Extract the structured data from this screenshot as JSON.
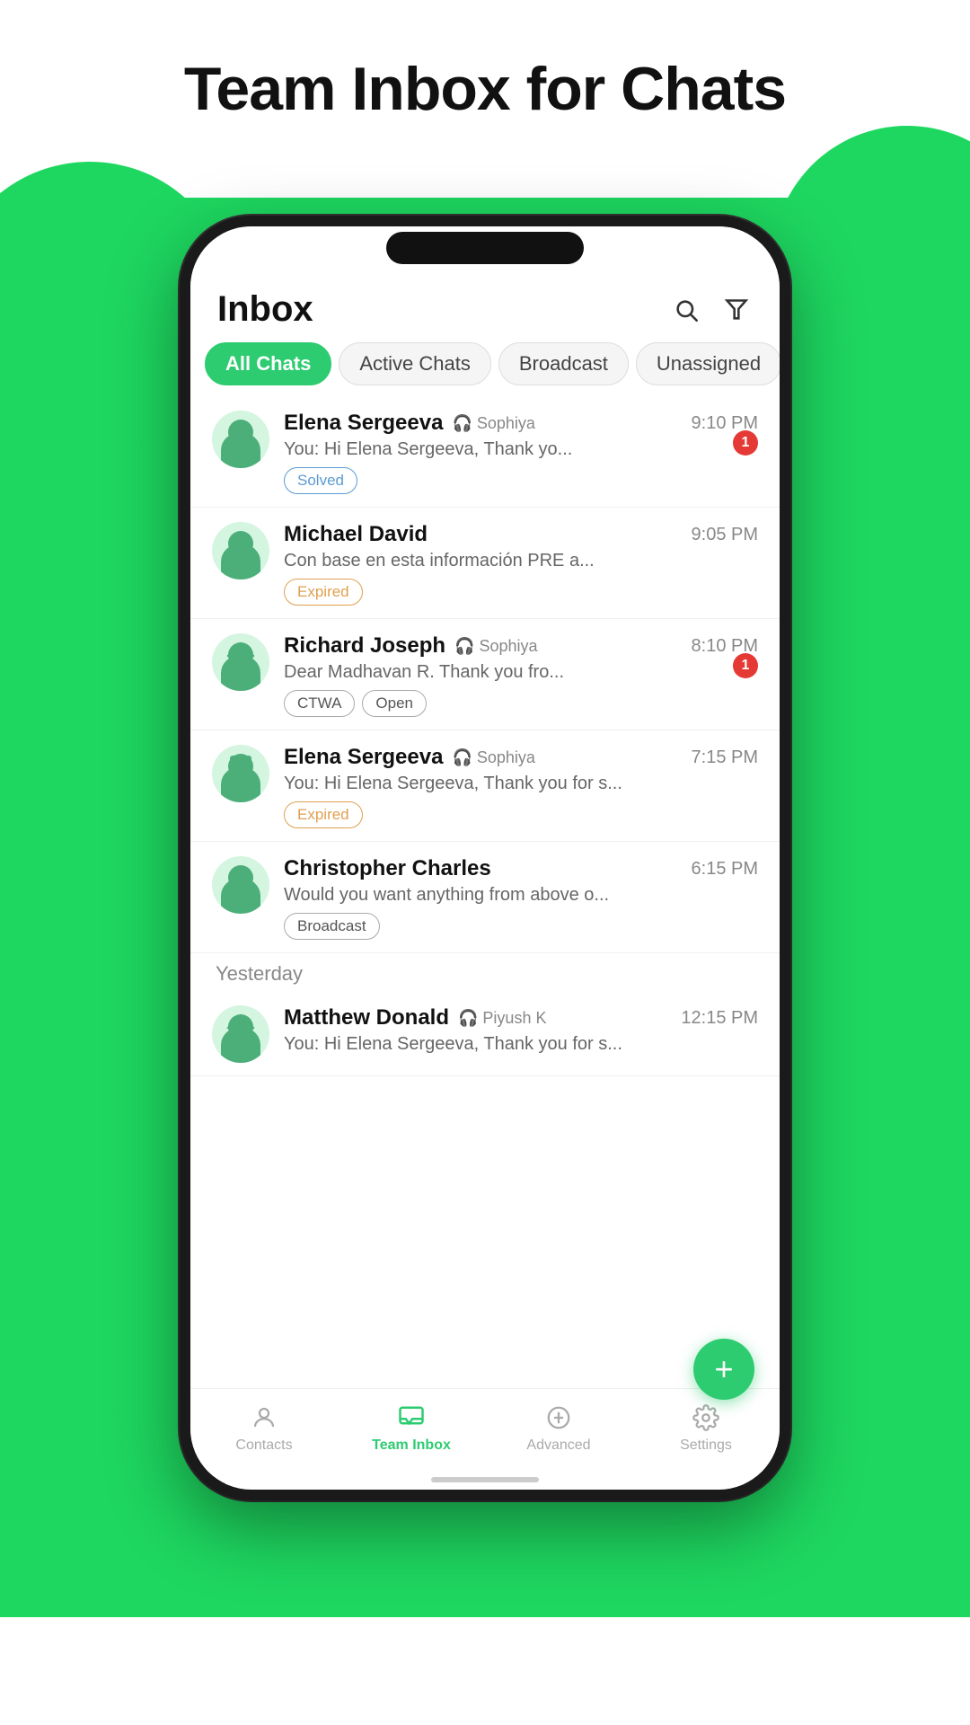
{
  "page": {
    "title": "Team Inbox for Chats",
    "background_color": "#1ED760"
  },
  "phone": {
    "header": {
      "title": "Inbox",
      "search_label": "search",
      "filter_label": "filter"
    },
    "tabs": [
      {
        "label": "All Chats",
        "active": true
      },
      {
        "label": "Active Chats",
        "active": false
      },
      {
        "label": "Broadcast",
        "active": false
      },
      {
        "label": "Unassigned",
        "active": false
      }
    ],
    "chats": [
      {
        "name": "Elena Sergeeva",
        "agent": "Sophiya",
        "time": "9:10 PM",
        "message": "You: Hi Elena Sergeeva, Thank yo...",
        "tags": [
          "Solved"
        ],
        "unread": 1,
        "avatar_type": "circle"
      },
      {
        "name": "Michael David",
        "agent": null,
        "time": "9:05 PM",
        "message": "Con base en esta información  PRE a...",
        "tags": [
          "Expired"
        ],
        "unread": 0,
        "avatar_type": "circle"
      },
      {
        "name": "Richard Joseph",
        "agent": "Sophiya",
        "time": "8:10 PM",
        "message": "Dear Madhavan R. Thank you fro...",
        "tags": [
          "CTWA",
          "Open"
        ],
        "unread": 1,
        "avatar_type": "diamond"
      },
      {
        "name": "Elena Sergeeva",
        "agent": "Sophiya",
        "time": "7:15 PM",
        "message": "You: Hi Elena Sergeeva, Thank you for s...",
        "tags": [
          "Expired"
        ],
        "unread": 0,
        "avatar_type": "square"
      },
      {
        "name": "Christopher Charles",
        "agent": null,
        "time": "6:15 PM",
        "message": "Would you want anything from above o...",
        "tags": [
          "Broadcast"
        ],
        "unread": 0,
        "avatar_type": "circle"
      }
    ],
    "section_yesterday": "Yesterday",
    "chats_yesterday": [
      {
        "name": "Matthew Donald",
        "agent": "Piyush K",
        "time": "12:15 PM",
        "message": "You: Hi Elena Sergeeva, Thank you for s...",
        "tags": [],
        "unread": 0,
        "avatar_type": "diamond"
      }
    ],
    "fab_label": "+",
    "bottom_nav": [
      {
        "label": "Contacts",
        "icon": "contacts",
        "active": false
      },
      {
        "label": "Team Inbox",
        "icon": "inbox",
        "active": true
      },
      {
        "label": "Advanced",
        "icon": "advanced",
        "active": false
      },
      {
        "label": "Settings",
        "icon": "settings",
        "active": false
      }
    ]
  }
}
